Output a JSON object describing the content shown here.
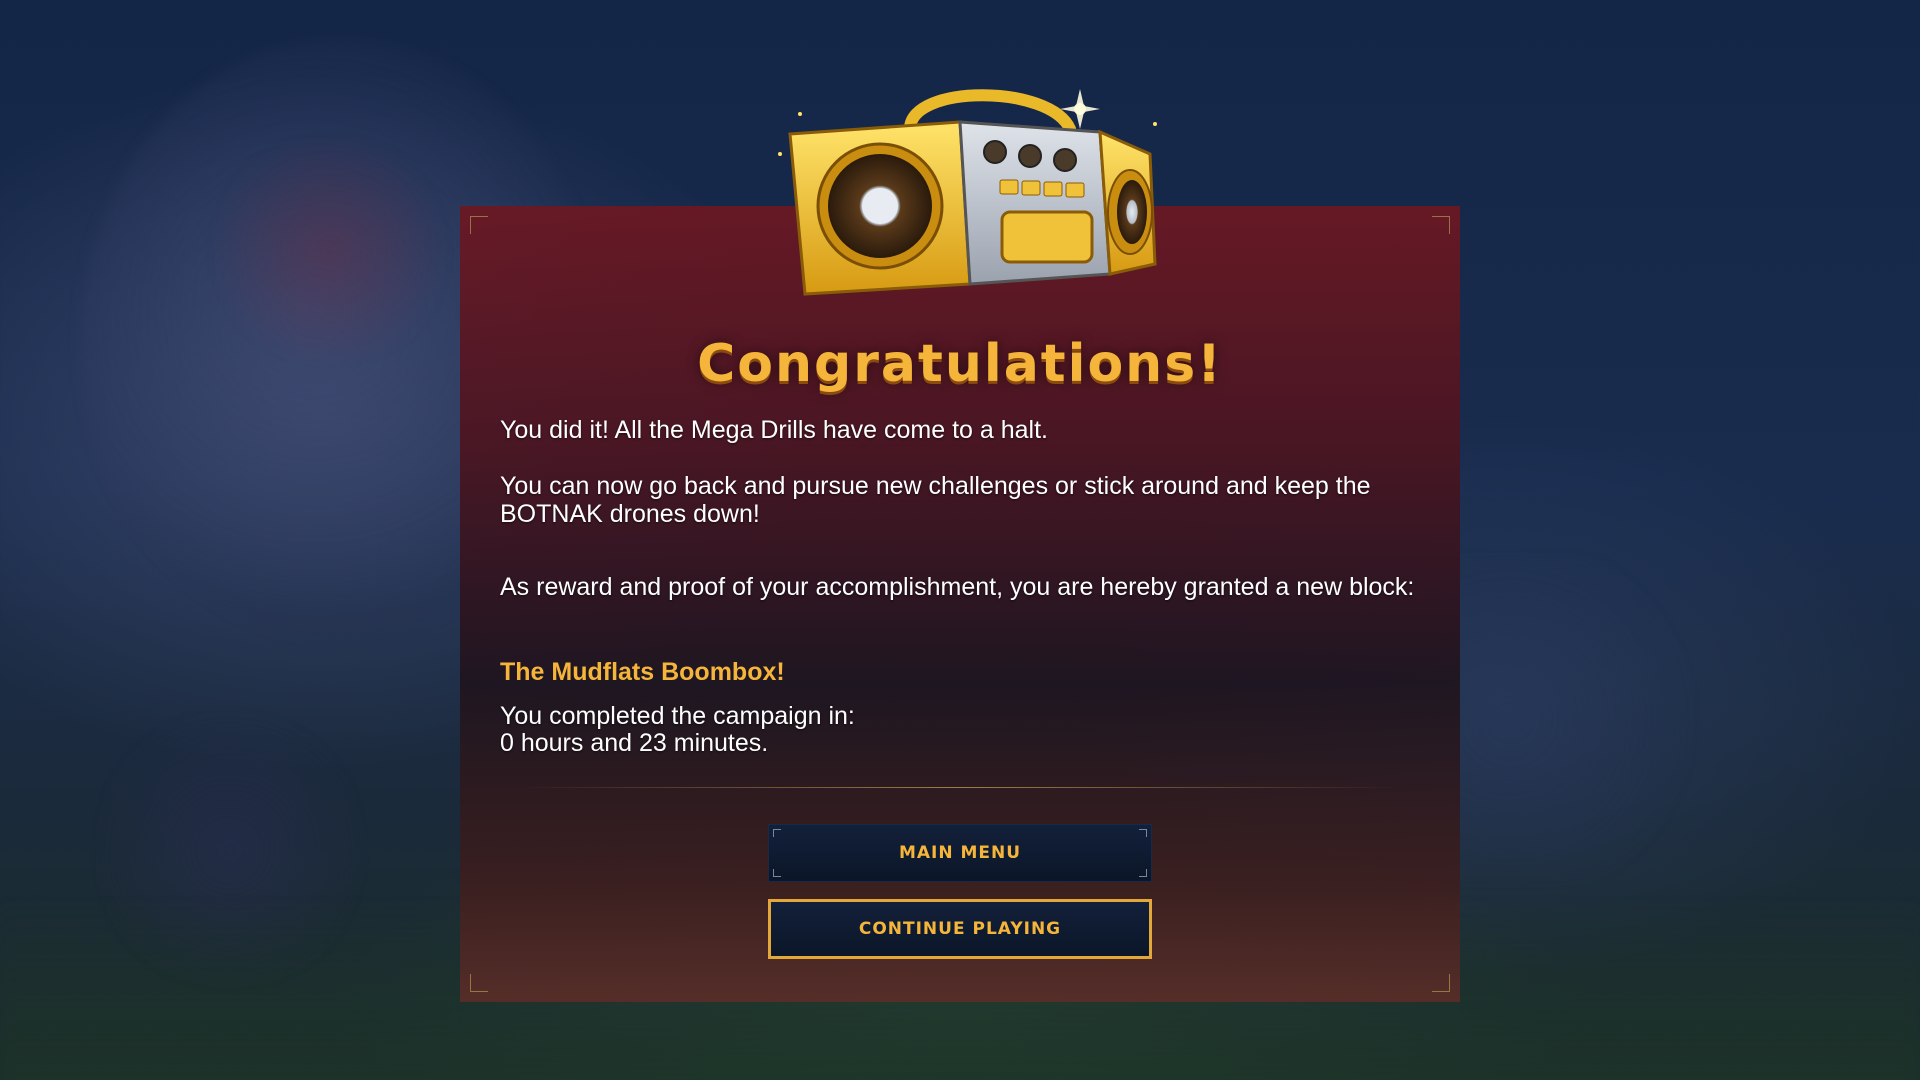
{
  "dialog": {
    "title": "Congratulations!",
    "paragraph1": "You did it! All the Mega Drills have come to a halt.",
    "paragraph2": "You can now go back and pursue new challenges or stick around and keep the BOTNAK drones down!",
    "paragraph3": "As reward and proof of your accomplishment, you are hereby granted a new block:",
    "reward_name": "The Mudflats Boombox!",
    "completion_label": "You completed the campaign in:",
    "completion_time": "0 hours and 23 minutes.",
    "reward_icon": "boombox-icon"
  },
  "buttons": {
    "main_menu": "MAIN MENU",
    "continue_playing": "CONTINUE PLAYING"
  },
  "colors": {
    "accent": "#f5b53a",
    "panel": "#6c1822",
    "button_bg": "#0b1628"
  }
}
